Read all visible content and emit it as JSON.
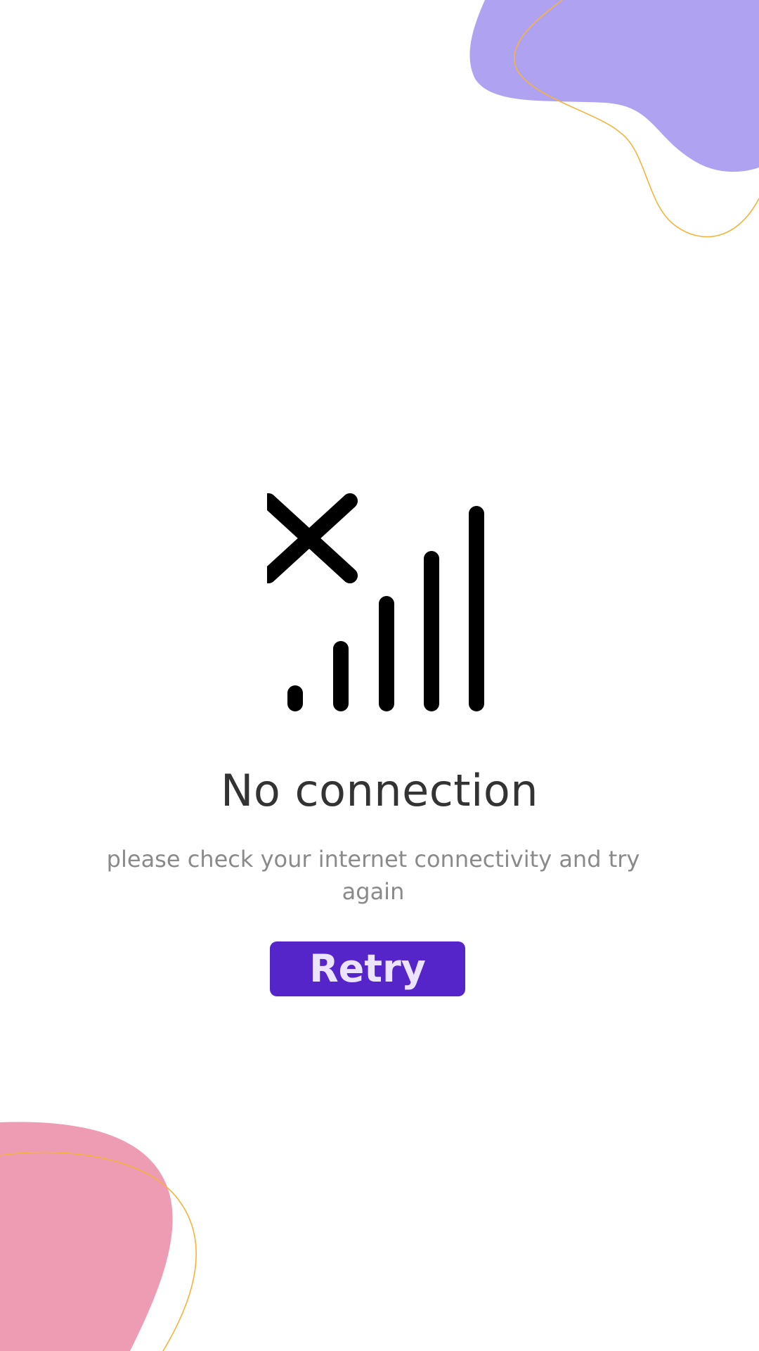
{
  "message": {
    "title": "No connection",
    "subtitle": "please check your internet connectivity and try again"
  },
  "actions": {
    "retry_label": "Retry"
  },
  "icons": {
    "status_icon": "signal-off-icon"
  },
  "colors": {
    "accent": "#5625c9",
    "button_text": "#ece4ff",
    "blob_top_right": "#afa3f1",
    "blob_bottom_left": "#ee9bb4",
    "outline": "#f5b33b",
    "title_text": "#333333",
    "subtitle_text": "#8a8a8a"
  }
}
